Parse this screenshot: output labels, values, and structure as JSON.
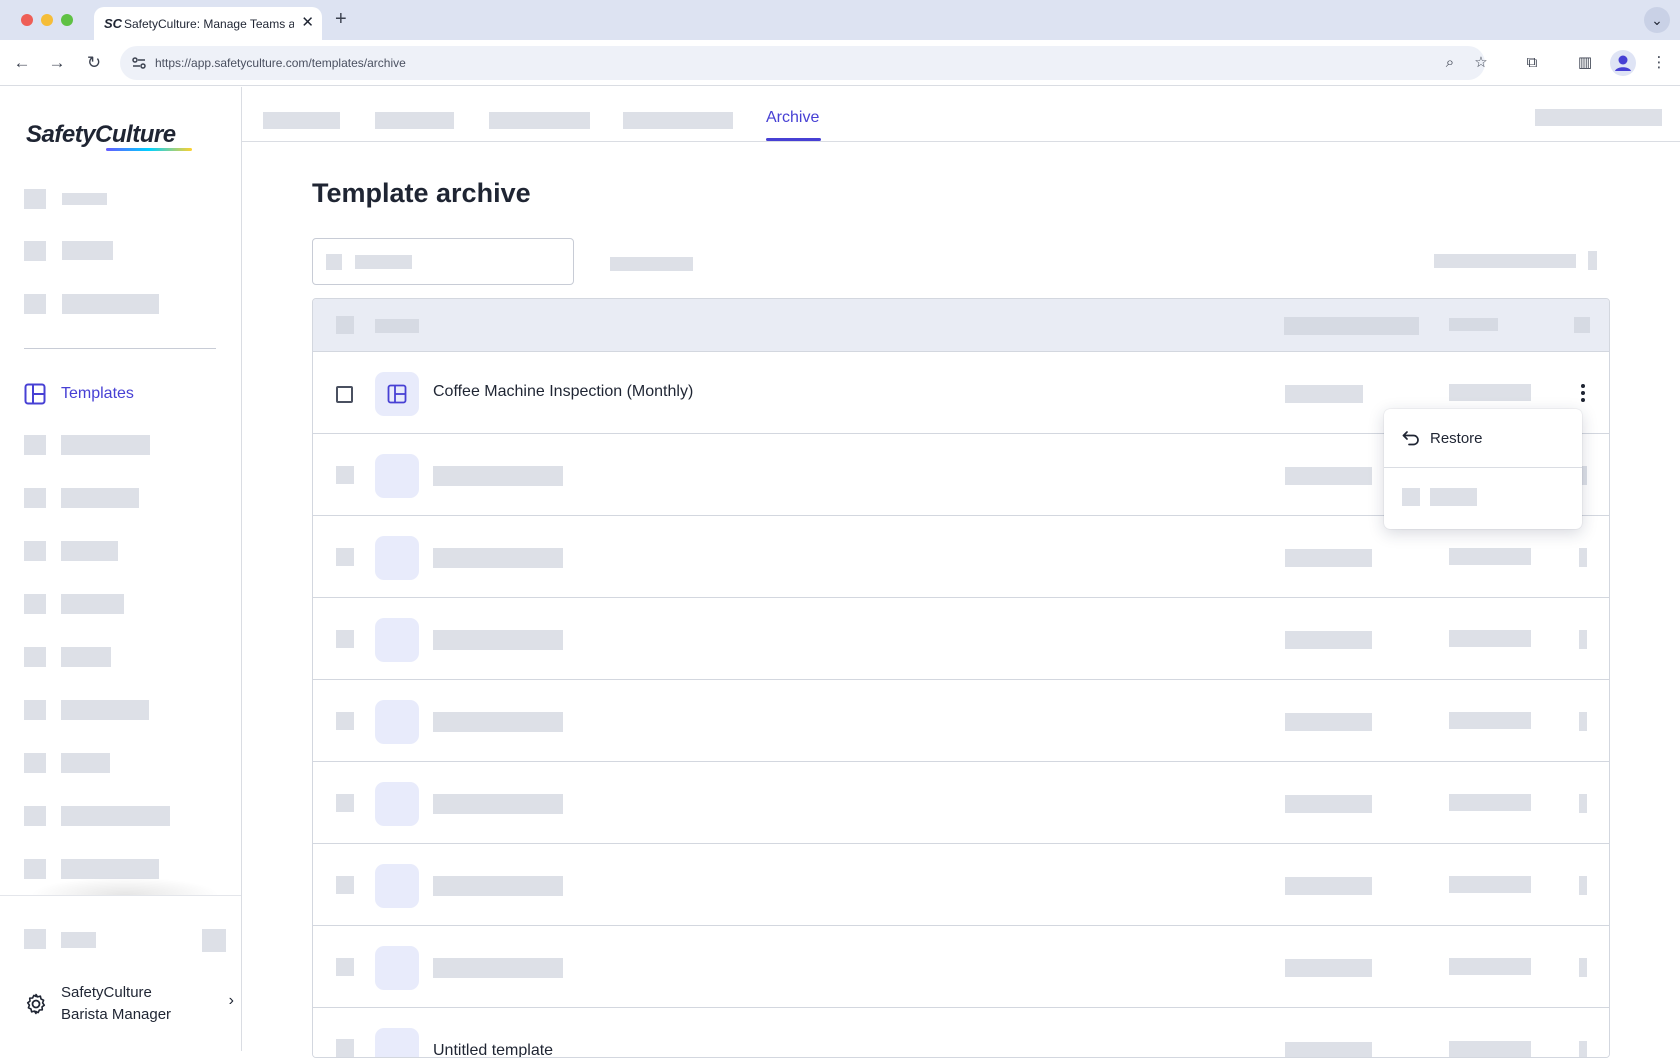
{
  "browser": {
    "tab_title": "SafetyCulture: Manage Teams and...",
    "tab_favicon_text": "SC",
    "url": "https://app.safetyculture.com/templates/archive",
    "icons": [
      "back-icon",
      "forward-icon",
      "reload-icon",
      "site-info-icon",
      "zoom-icon",
      "bookmark-star-icon",
      "extensions-icon",
      "side-panel-icon",
      "profile-icon",
      "menu-kebab-icon"
    ]
  },
  "sidebar": {
    "logo": "SafetyCulture",
    "active_item": {
      "label": "Templates",
      "icon": "templates-icon"
    },
    "org": {
      "line1": "SafetyCulture",
      "line2": "Barista Manager",
      "icon": "gear-icon"
    }
  },
  "main": {
    "active_tab": "Archive",
    "page_title": "Template archive",
    "rows": [
      {
        "title": "Coffee Machine Inspection (Monthly)",
        "icon": "template-layout-icon"
      },
      {
        "title": "Untitled template"
      }
    ],
    "row_menu": {
      "restore_label": "Restore",
      "restore_icon": "undo-arrow-icon"
    }
  },
  "colors": {
    "accent": "#4740d4",
    "skeleton": "#dde0e7",
    "header_bg": "#e9ecf4",
    "thumb_bg": "#e8ebfb"
  }
}
